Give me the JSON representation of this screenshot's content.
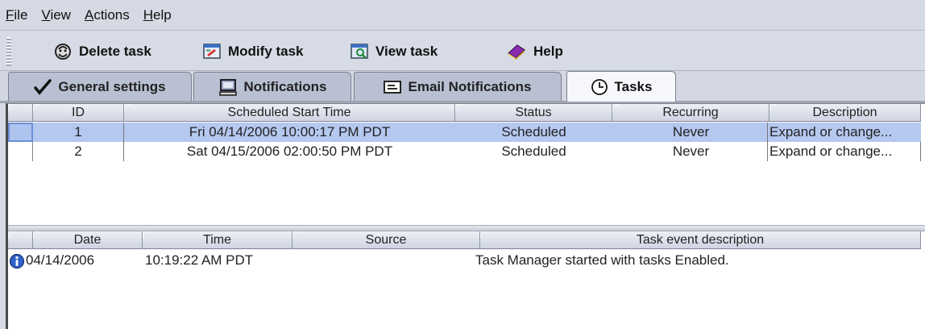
{
  "menu": [
    {
      "mnemonic": "F",
      "rest": "ile"
    },
    {
      "mnemonic": "V",
      "rest": "iew"
    },
    {
      "mnemonic": "A",
      "rest": "ctions"
    },
    {
      "mnemonic": "H",
      "rest": "elp"
    }
  ],
  "toolbar": {
    "delete_label": "Delete task",
    "modify_label": "Modify task",
    "view_label": "View task",
    "help_label": "Help"
  },
  "tabs": {
    "general": "General settings",
    "notifications": "Notifications",
    "email": "Email Notifications",
    "tasks": "Tasks",
    "active": "Tasks"
  },
  "tasks_table": {
    "columns": [
      "ID",
      "Scheduled Start Time",
      "Status",
      "Recurring",
      "Description"
    ],
    "rows": [
      {
        "id": "1",
        "start": "Fri 04/14/2006 10:00:17 PM PDT",
        "status": "Scheduled",
        "recurring": "Never",
        "description": "Expand or change...",
        "selected": true
      },
      {
        "id": "2",
        "start": "Sat 04/15/2006 02:00:50 PM PDT",
        "status": "Scheduled",
        "recurring": "Never",
        "description": "Expand or change...",
        "selected": false
      }
    ]
  },
  "events_table": {
    "columns": [
      "Date",
      "Time",
      "Source",
      "Task event description"
    ],
    "rows": [
      {
        "icon": "info-icon",
        "date": "04/14/2006",
        "time": "10:19:22 AM PDT",
        "source": "",
        "description": "Task Manager started with tasks Enabled."
      }
    ]
  },
  "colors": {
    "selection": "#b5c8f0",
    "background": "#d7dbe5",
    "info_icon": "#2e62c9"
  }
}
